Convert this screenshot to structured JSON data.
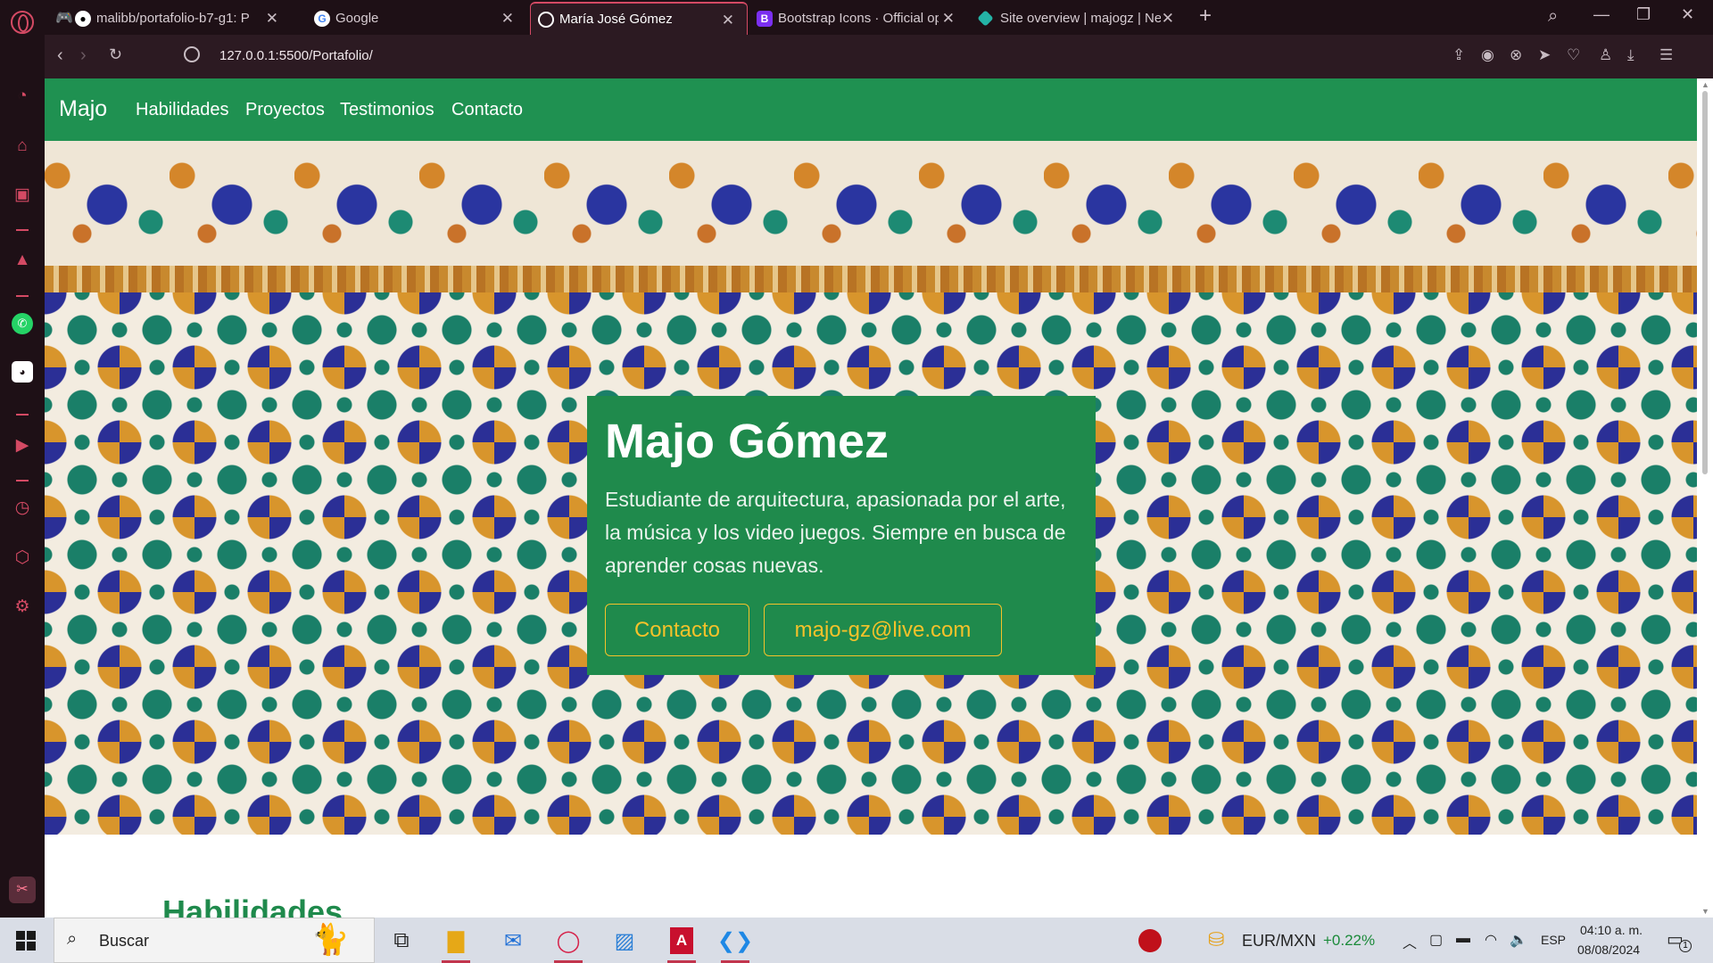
{
  "browser": {
    "tabs": [
      {
        "title": "malibb/portafolio-b7-g1: P",
        "icon": "github-icon"
      },
      {
        "title": "Google",
        "icon": "google-icon"
      },
      {
        "title": "María José Gómez",
        "icon": "globe-icon",
        "active": true
      },
      {
        "title": "Bootstrap Icons · Official op",
        "icon": "bootstrap-icon"
      },
      {
        "title": "Site overview | majogz | Ne",
        "icon": "netlify-icon"
      }
    ],
    "url": "127.0.0.1:5500/Portafolio/",
    "accent_color": "#d44a64"
  },
  "site": {
    "brand": "Majo",
    "nav": [
      "Habilidades",
      "Proyectos",
      "Testimonios",
      "Contacto"
    ],
    "nav_color": "#1f9151",
    "hero": {
      "name": "Majo Gómez",
      "bio": "Estudiante de arquitectura, apasionada por el arte, la música y los video juegos. Siempre en busca de aprender cosas nuevas.",
      "buttons": [
        "Contacto",
        "majo-gz@live.com"
      ],
      "button_color": "#f5c22a"
    },
    "next_section_heading": "Habilidades"
  },
  "taskbar": {
    "search_placeholder": "Buscar",
    "fx_pair": "EUR/MXN",
    "fx_change": "+0.22%",
    "language": "ESP",
    "time": "04:10 a. m.",
    "date": "08/08/2024",
    "notification_count": "1"
  }
}
